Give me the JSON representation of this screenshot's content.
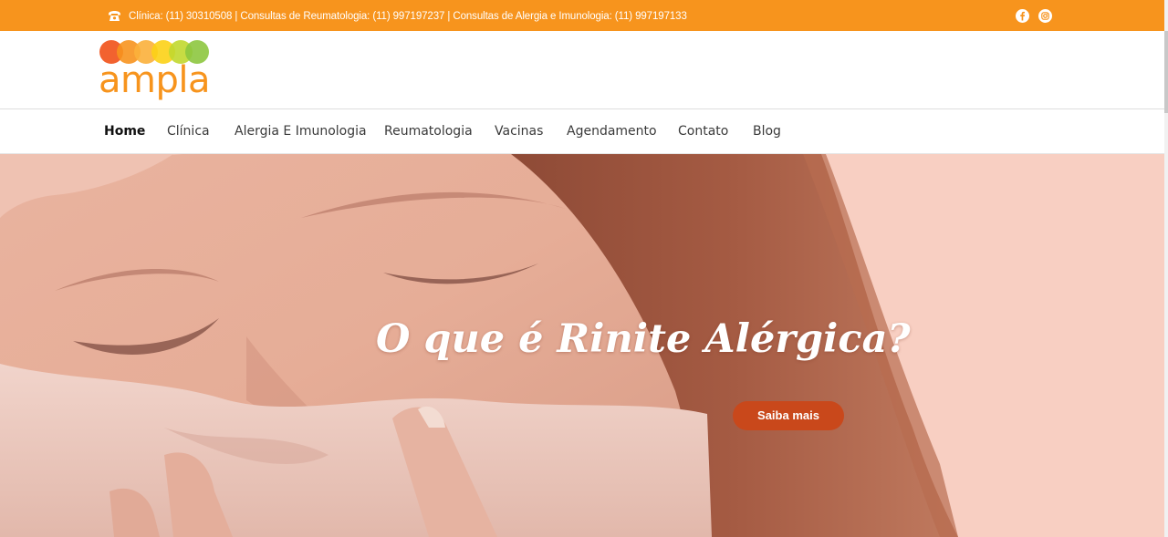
{
  "topbar": {
    "contact_text": "Clínica: (11) 30310508 | Consultas de Reumatologia: (11) 997197237 | Consultas de Alergia e Imunologia: (11) 997197133",
    "phone_icon": "phone-icon",
    "social": [
      {
        "icon": "facebook-icon"
      },
      {
        "icon": "instagram-icon"
      }
    ],
    "background_color": "#f7941d"
  },
  "logo": {
    "text": "ampla",
    "dot_colors": [
      "#f15a24",
      "#f7931e",
      "#fbb03b",
      "#fcd116",
      "#c1d82f",
      "#8dc63f"
    ],
    "text_color": "#f7941d"
  },
  "nav": {
    "items": [
      {
        "label": "Home",
        "active": true
      },
      {
        "label": "Clínica"
      },
      {
        "label": "Alergia E Imunologia"
      },
      {
        "label": "Reumatologia"
      },
      {
        "label": "Vacinas"
      },
      {
        "label": "Agendamento"
      },
      {
        "label": "Contato"
      },
      {
        "label": "Blog"
      }
    ]
  },
  "hero": {
    "title": "O que é Rinite Alérgica?",
    "button_label": "Saiba mais",
    "button_color": "#c9481b",
    "background_color": "#f8cfc2"
  }
}
